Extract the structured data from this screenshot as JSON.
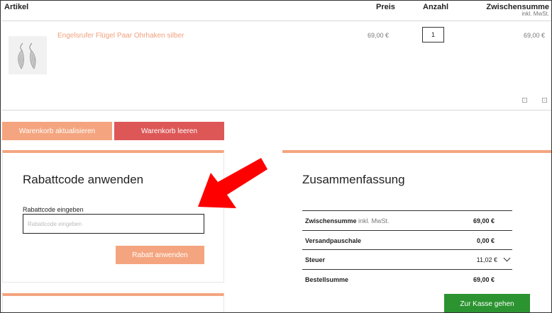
{
  "cart_table": {
    "headers": {
      "article": "Artikel",
      "price": "Preis",
      "quantity": "Anzahl",
      "subtotal": "Zwischensumme",
      "subtotal_note": "inkl. MwSt."
    },
    "items": [
      {
        "name": "Engelsrufer Flügel Paar Ohrhaken silber",
        "price": "69,00 €",
        "quantity": "1",
        "subtotal": "69,00 €"
      }
    ]
  },
  "cart_actions": {
    "update_label": "Warenkorb aktualisieren",
    "clear_label": "Warenkorb leeren"
  },
  "coupon": {
    "title": "Rabattcode anwenden",
    "field_label": "Rabattcode eingeben",
    "placeholder": "Rabattcode eingeben",
    "apply_label": "Rabatt anwenden"
  },
  "summary": {
    "title": "Zusammenfassung",
    "rows": [
      {
        "label": "Zwischensumme",
        "sublabel": "inkl. MwSt.",
        "value": "69,00 €"
      },
      {
        "label": "Versandpauschale",
        "sublabel": "",
        "value": "0,00 €"
      },
      {
        "label": "Steuer",
        "sublabel": "",
        "value": "11,02 €"
      },
      {
        "label": "Bestellsumme",
        "sublabel": "",
        "value": "69,00 €"
      }
    ],
    "checkout_label": "Zur Kasse gehen"
  },
  "colors": {
    "accent_orange": "#f4a57f",
    "danger_red": "#dd5757",
    "checkout_green": "#2b9430",
    "annotation_red": "#ff0000"
  },
  "icons": {
    "tax_toggle": "chevron-down-icon",
    "row_actions": [
      "edit-icon",
      "remove-icon"
    ]
  }
}
